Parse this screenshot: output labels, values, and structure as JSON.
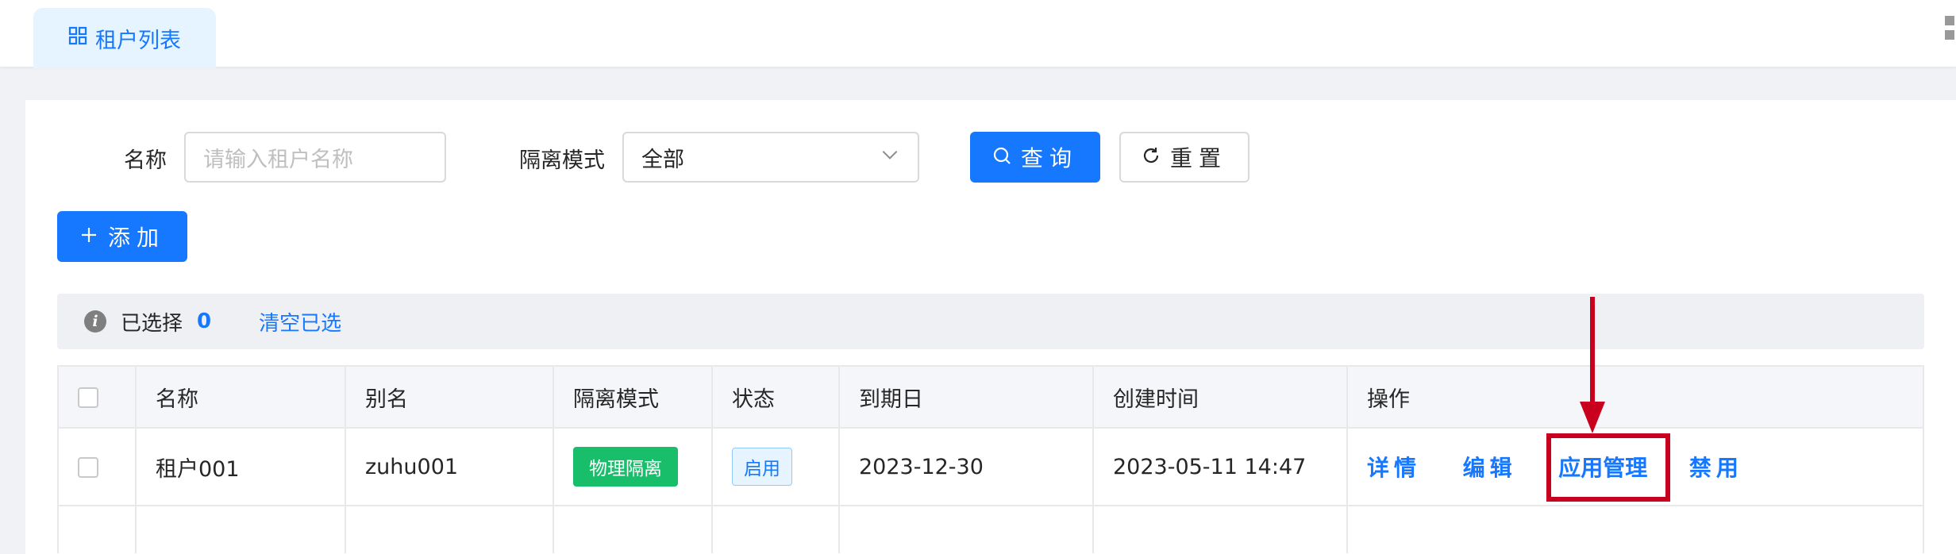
{
  "tabs": [
    {
      "label": "租户列表",
      "icon": "grid-icon"
    }
  ],
  "search": {
    "name_label": "名称",
    "name_placeholder": "请输入租户名称",
    "isolation_label": "隔离模式",
    "isolation_value": "全部",
    "query_label": "查询",
    "reset_label": "重置"
  },
  "toolbar": {
    "add_label": "添加"
  },
  "selection": {
    "selected_label": "已选择",
    "count": "0",
    "clear_label": "清空已选"
  },
  "table": {
    "headers": [
      "名称",
      "别名",
      "隔离模式",
      "状态",
      "到期日",
      "创建时间",
      "操作"
    ],
    "rows": [
      {
        "name": "租户001",
        "alias": "zuhu001",
        "isolation": "物理隔离",
        "status": "启用",
        "expire": "2023-12-30",
        "created": "2023-05-11 14:47",
        "actions": [
          "详情",
          "编辑",
          "应用管理",
          "禁用"
        ]
      }
    ]
  },
  "colors": {
    "primary": "#1677ff",
    "success": "#19be6b",
    "annotation": "#c8001e"
  }
}
